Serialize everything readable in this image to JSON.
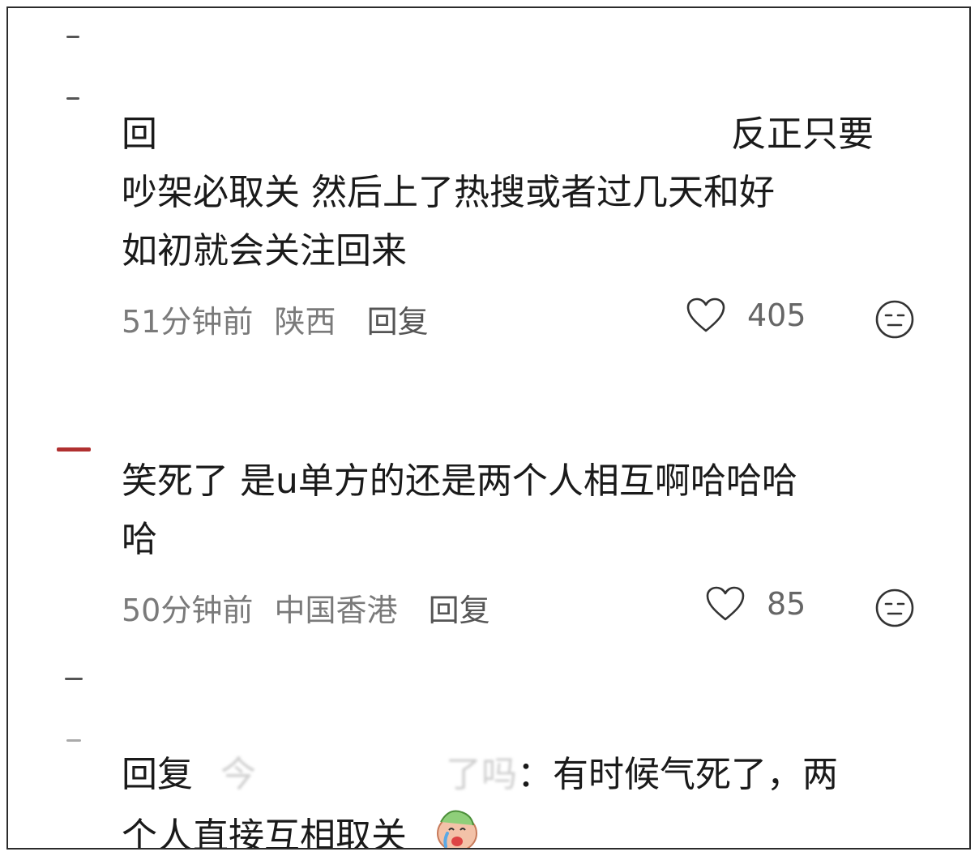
{
  "comments": [
    {
      "line1_left": "回",
      "line1_right": "反正只要",
      "line2": "吵架必取关 然后上了热搜或者过几天和好",
      "line3": "如初就会关注回来",
      "time": "51分钟前",
      "location": "陕西",
      "reply_label": "回复",
      "likes": "405"
    },
    {
      "line1": "笑死了 是u单方的还是两个人相互啊哈哈哈",
      "line2": "哈",
      "time": "50分钟前",
      "location": "中国香港",
      "reply_label": "回复",
      "likes": "85"
    },
    {
      "reply_prefix": "回复",
      "reply_to_partial": "今 　　　　　了吗",
      "line1_rest": "：有时候气死了，两",
      "line2": "个人直接互相取关"
    }
  ],
  "icons": {
    "like": "heart-outline-icon",
    "dislike": "neutral-face-icon",
    "sticker": "crying-emoji-sticker"
  },
  "colors": {
    "text": "#1a1a1a",
    "meta": "#7a7a7a",
    "border": "#2b2b2b",
    "accent_avatar": "#b03030"
  }
}
